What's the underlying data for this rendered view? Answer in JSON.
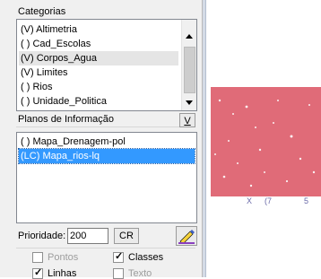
{
  "categorias": {
    "title": "Categorias",
    "items": [
      "(V) Altimetria",
      "( ) Cad_Escolas",
      "(V) Corpos_Agua",
      "(V) Limites",
      "( ) Rios",
      "( ) Unidade_Politica"
    ],
    "selected_index": 2
  },
  "planos": {
    "title": "Planos de Informação",
    "v_button": "V",
    "items": [
      "( ) Mapa_Drenagem-pol",
      "(LC) Mapa_rios-lq"
    ],
    "selected_index": 1
  },
  "prioridade": {
    "label": "Prioridade:",
    "value": "200",
    "cr_button": "CR"
  },
  "checks": [
    {
      "label": "Pontos",
      "checked": false,
      "disabled": true
    },
    {
      "label": "Classes",
      "checked": true,
      "disabled": false
    },
    {
      "label": "Linhas",
      "checked": true,
      "disabled": false
    },
    {
      "label": "Texto",
      "checked": false,
      "disabled": true
    }
  ],
  "colors": {
    "selection_blue": "#3399ff",
    "map_fill": "#e06b78"
  },
  "map_labels": [
    "X",
    "(7",
    "5"
  ]
}
